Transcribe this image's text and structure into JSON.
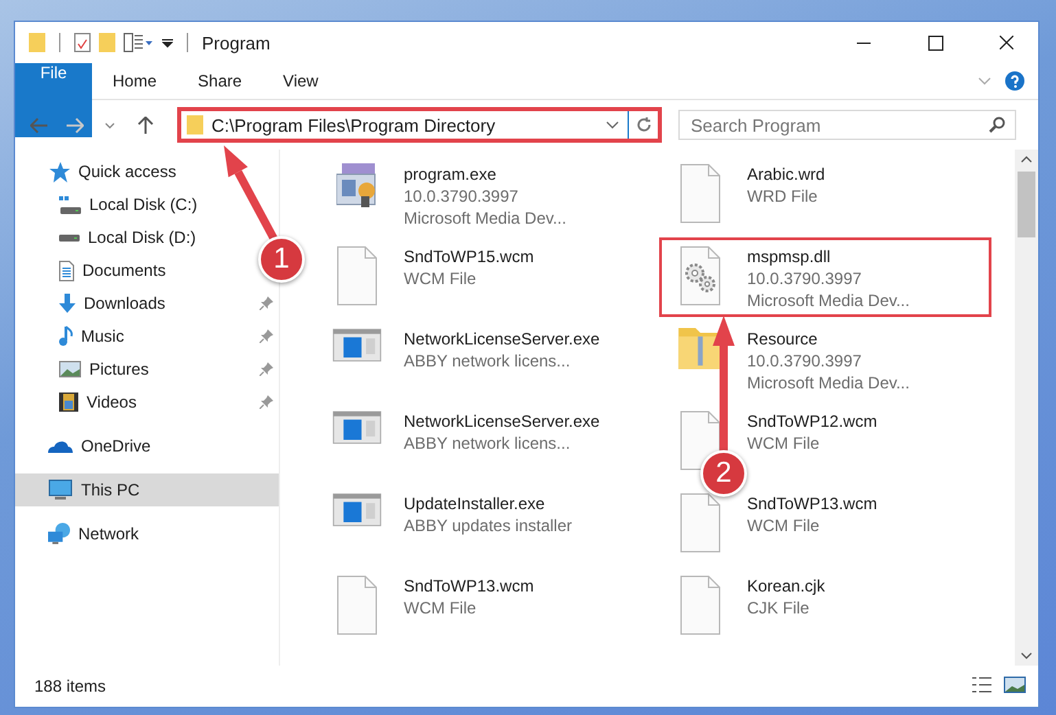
{
  "window": {
    "title": "Program"
  },
  "ribbon_tabs": [
    {
      "label": "File",
      "kind": "file-menu"
    },
    {
      "label": "Home",
      "kind": "tab"
    },
    {
      "label": "Share",
      "kind": "tab"
    },
    {
      "label": "View",
      "kind": "tab"
    }
  ],
  "address_bar": {
    "path": "C:\\Program Files\\Program Directory",
    "highlighted": true
  },
  "search": {
    "placeholder": "Search Program"
  },
  "navigation": [
    {
      "label": "Quick access",
      "selected": false,
      "children": [
        {
          "label": "Local Disk (C:)",
          "pinned": false,
          "selected": false
        },
        {
          "label": "Local Disk (D:)",
          "pinned": false,
          "selected": false
        },
        {
          "label": "Documents",
          "pinned": false,
          "selected": false
        },
        {
          "label": "Downloads",
          "pinned": true,
          "selected": false
        },
        {
          "label": "Music",
          "pinned": true,
          "selected": false
        },
        {
          "label": "Pictures",
          "pinned": true,
          "selected": false
        },
        {
          "label": "Videos",
          "pinned": true,
          "selected": false
        }
      ]
    },
    {
      "label": "OneDrive",
      "selected": false
    },
    {
      "label": "This PC",
      "selected": true
    },
    {
      "label": "Network",
      "selected": false
    }
  ],
  "files": [
    {
      "name": "program.exe",
      "details": [
        "10.0.3790.3997",
        "Microsoft Media Dev..."
      ],
      "kind": "installer",
      "highlighted": false
    },
    {
      "name": "Arabic.wrd",
      "details": [
        "WRD File"
      ],
      "kind": "document",
      "highlighted": false
    },
    {
      "name": "SndToWP15.wcm",
      "details": [
        "WCM File"
      ],
      "kind": "document",
      "highlighted": false
    },
    {
      "name": "mspmsp.dll",
      "details": [
        "10.0.3790.3997",
        "Microsoft Media Dev..."
      ],
      "kind": "library",
      "highlighted": true
    },
    {
      "name": "NetworkLicenseServer.exe",
      "details": [
        "ABBY network licens..."
      ],
      "kind": "application",
      "highlighted": false
    },
    {
      "name": "Resource",
      "details": [
        "10.0.3790.3997",
        "Microsoft Media Dev..."
      ],
      "kind": "folder",
      "highlighted": false
    },
    {
      "name": "NetworkLicenseServer.exe",
      "details": [
        "ABBY network licens..."
      ],
      "kind": "application",
      "highlighted": false
    },
    {
      "name": "SndToWP12.wcm",
      "details": [
        "WCM File"
      ],
      "kind": "document",
      "highlighted": false
    },
    {
      "name": "UpdateInstaller.exe",
      "details": [
        "ABBY updates installer"
      ],
      "kind": "application",
      "highlighted": false
    },
    {
      "name": "SndToWP13.wcm",
      "details": [
        "WCM File"
      ],
      "kind": "document",
      "highlighted": false
    },
    {
      "name": "SndToWP13.wcm",
      "details": [
        "WCM File"
      ],
      "kind": "document",
      "highlighted": false
    },
    {
      "name": "Korean.cjk",
      "details": [
        "CJK File"
      ],
      "kind": "document",
      "highlighted": false
    }
  ],
  "status_bar": {
    "item_count": "188 items"
  },
  "callouts": [
    {
      "number": "1"
    },
    {
      "number": "2"
    }
  ]
}
